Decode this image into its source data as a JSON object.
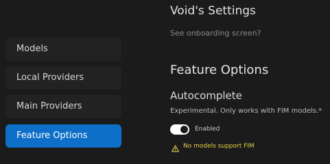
{
  "sidebar": {
    "items": [
      {
        "label": "Models"
      },
      {
        "label": "Local Providers"
      },
      {
        "label": "Main Providers"
      },
      {
        "label": "Feature Options"
      }
    ]
  },
  "main": {
    "settings_title": "Void's Settings",
    "onboarding_link": "See onboarding screen?",
    "feature_title": "Feature Options",
    "autocomplete": {
      "title": "Autocomplete",
      "description": "Experimental. Only works with FIM models.*",
      "toggle_label": "Enabled",
      "toggle_state": "on",
      "warning": "No models support FIM"
    }
  },
  "colors": {
    "background": "#1b1b1b",
    "accent": "#0e6fc8",
    "warning": "#e5d24a"
  },
  "icons": {
    "warning": "warning-triangle-icon"
  }
}
